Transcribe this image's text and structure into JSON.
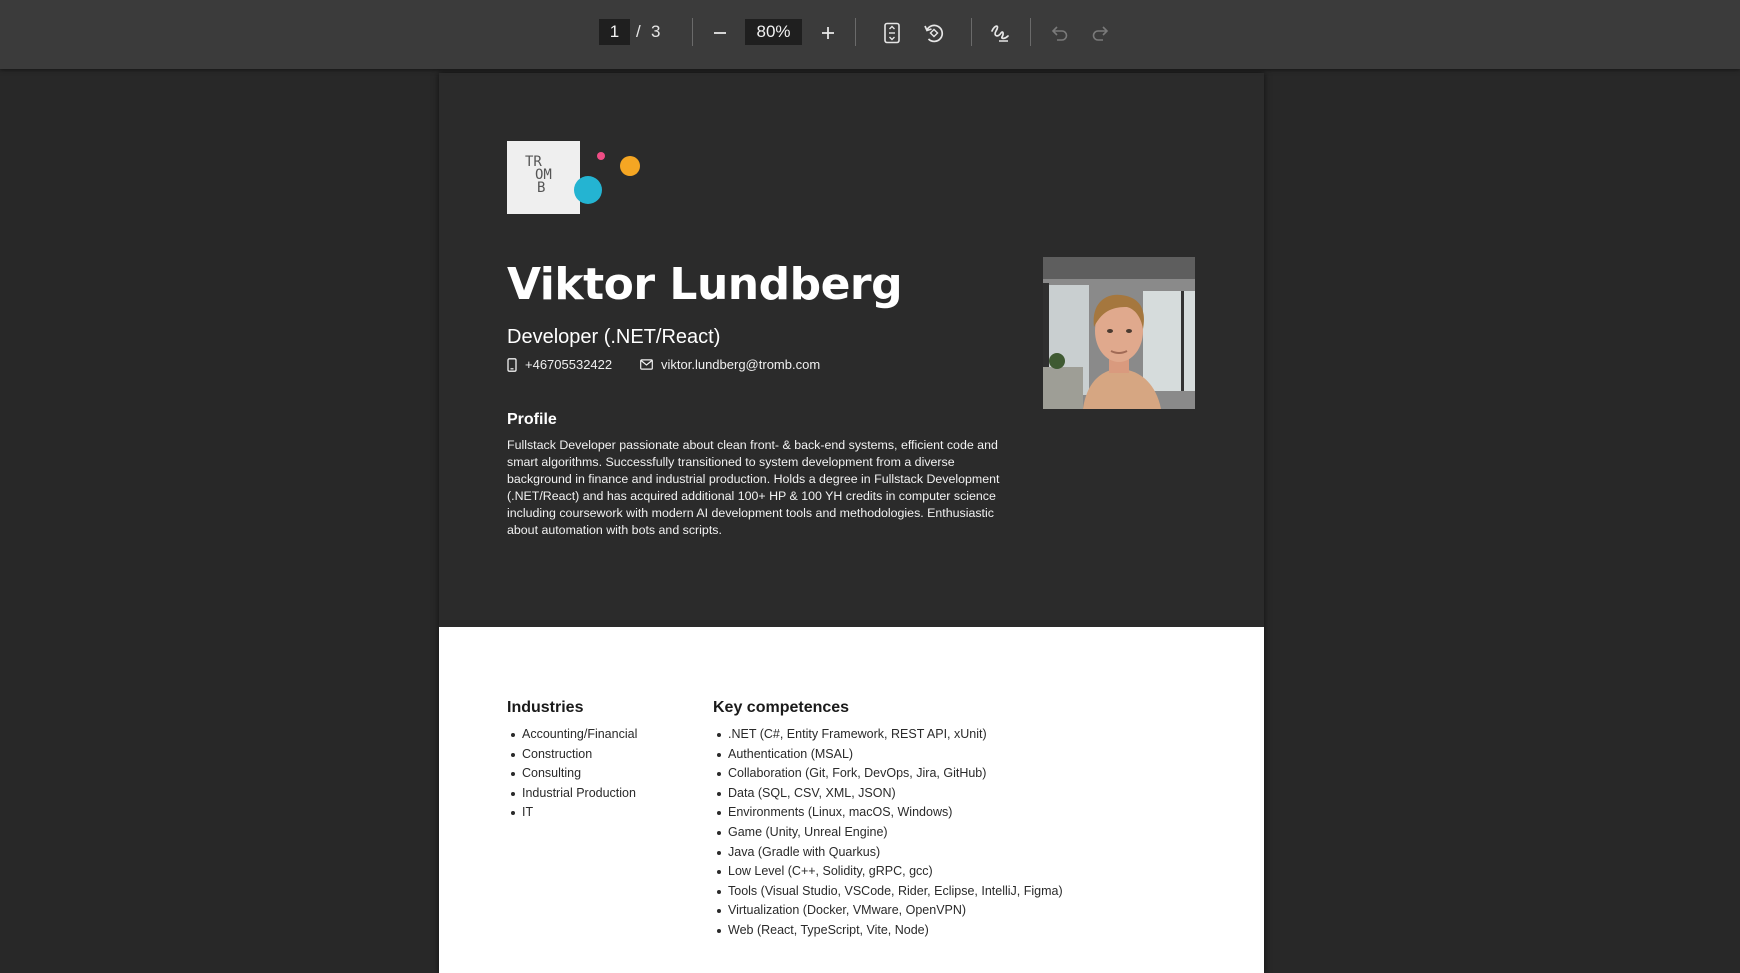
{
  "toolbar": {
    "current_page": "1",
    "page_separator": "/",
    "total_pages": "3",
    "zoom": "80%"
  },
  "logo": {
    "text_lines": [
      "TR",
      "OM",
      "B"
    ]
  },
  "profile": {
    "name": "Viktor Lundberg",
    "role": "Developer (.NET/React)",
    "phone": "+46705532422",
    "email": "viktor.lundberg@tromb.com",
    "section_title": "Profile",
    "summary": "Fullstack Developer passionate about clean front- & back-end systems, efficient code and smart algorithms. Successfully transitioned to system development from a diverse background in finance and industrial production. Holds a degree in Fullstack Development (.NET/React) and has acquired additional 100+ HP & 100 YH credits in computer science including coursework with modern AI development tools and methodologies. Enthusiastic about automation with bots and scripts."
  },
  "industries": {
    "title": "Industries",
    "items": [
      "Accounting/Financial",
      "Construction",
      "Consulting",
      "Industrial Production",
      "IT"
    ]
  },
  "competences": {
    "title": "Key competences",
    "items": [
      ".NET (C#, Entity Framework, REST API, xUnit)",
      "Authentication (MSAL)",
      "Collaboration (Git, Fork, DevOps, Jira, GitHub)",
      "Data (SQL, CSV, XML, JSON)",
      "Environments (Linux, macOS, Windows)",
      "Game (Unity, Unreal Engine)",
      "Java (Gradle with Quarkus)",
      "Low Level (C++, Solidity, gRPC, gcc)",
      "Tools (Visual Studio, VSCode, Rider, Eclipse, IntelliJ, Figma)",
      "Virtualization (Docker, VMware, OpenVPN)",
      "Web (React, TypeScript, Vite, Node)"
    ]
  },
  "colors": {
    "toolbar_bg": "#3b3b3b",
    "viewer_bg": "#282828",
    "header_bg": "#2b2b2b",
    "accent_pink": "#ef4d85",
    "accent_orange": "#f5a623",
    "accent_blue": "#24b4d2"
  },
  "icons": {
    "zoom_out": "minus-icon",
    "zoom_in": "plus-icon",
    "fit": "fit-page-icon",
    "rotate": "rotate-icon",
    "draw": "draw-icon",
    "undo": "undo-icon",
    "redo": "redo-icon",
    "phone": "phone-icon",
    "email": "mail-icon"
  }
}
